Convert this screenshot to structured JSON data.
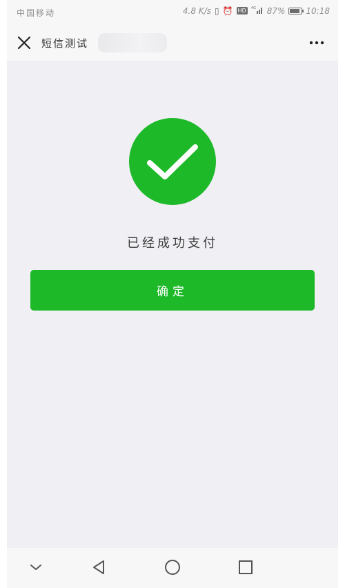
{
  "status_bar": {
    "carrier": "中国移动",
    "speed": "4.8 K/s",
    "hd": "HD",
    "network": "4G",
    "battery_percent": "87%",
    "battery_level": 0.87,
    "time": "10:18"
  },
  "nav_bar": {
    "title": "短信测试",
    "close_icon": "close-icon",
    "more_icon": "more-horizontal-icon"
  },
  "main": {
    "success_icon": "check-circle-icon",
    "success_message": "已经成功支付",
    "confirm_label": "确定"
  },
  "system_nav": {
    "icons": [
      "chevron-down-icon",
      "back-triangle-icon",
      "home-circle-icon",
      "recents-square-icon"
    ]
  },
  "colors": {
    "accent_green": "#1db929",
    "background": "#f0eff4",
    "bar_background": "#f7f7f8"
  }
}
